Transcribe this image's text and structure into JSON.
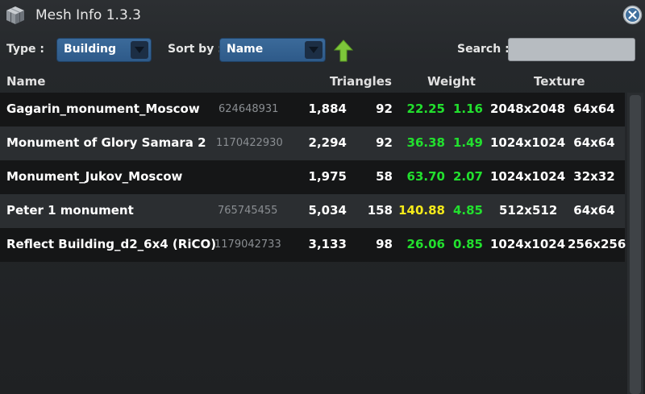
{
  "window": {
    "title": "Mesh Info 1.3.3",
    "icon": "mesh-cube-icon",
    "close_icon": "close-icon"
  },
  "toolbar": {
    "type_label": "Type :",
    "type_value": "Building",
    "sort_label": "Sort by :",
    "sort_value": "Name",
    "sort_direction_icon": "arrow-up-icon",
    "search_label": "Search :",
    "search_value": ""
  },
  "columns": {
    "name": "Name",
    "triangles": "Triangles",
    "weight": "Weight",
    "texture": "Texture"
  },
  "rows": [
    {
      "name": "Gagarin_monument_Moscow",
      "id": "624648931",
      "triangles": "1,884",
      "lod_triangles": "92",
      "weight": "22.25",
      "lod_weight": "1.16",
      "texture": "2048x2048",
      "lod_texture": "64x64",
      "weight_color": "green"
    },
    {
      "name": "Monument of Glory Samara 2",
      "id": "1170422930",
      "triangles": "2,294",
      "lod_triangles": "92",
      "weight": "36.38",
      "lod_weight": "1.49",
      "texture": "1024x1024",
      "lod_texture": "64x64",
      "weight_color": "green"
    },
    {
      "name": "Monument_Jukov_Moscow",
      "id": "",
      "triangles": "1,975",
      "lod_triangles": "58",
      "weight": "63.70",
      "lod_weight": "2.07",
      "texture": "1024x1024",
      "lod_texture": "32x32",
      "weight_color": "green"
    },
    {
      "name": "Peter 1 monument",
      "id": "765745455",
      "triangles": "5,034",
      "lod_triangles": "158",
      "weight": "140.88",
      "lod_weight": "4.85",
      "texture": "512x512",
      "lod_texture": "64x64",
      "weight_color": "yellow"
    },
    {
      "name": "Reflect Building_d2_6x4 (RiCO)",
      "id": "1179042733",
      "triangles": "3,133",
      "lod_triangles": "98",
      "weight": "26.06",
      "lod_weight": "0.85",
      "texture": "1024x1024",
      "lod_texture": "256x256",
      "weight_color": "green"
    }
  ],
  "colors": {
    "weight_ok": "#22e02e",
    "weight_warn": "#f5ea1a",
    "sort_arrow": "#7dc63a",
    "dropdown": "#346395"
  }
}
